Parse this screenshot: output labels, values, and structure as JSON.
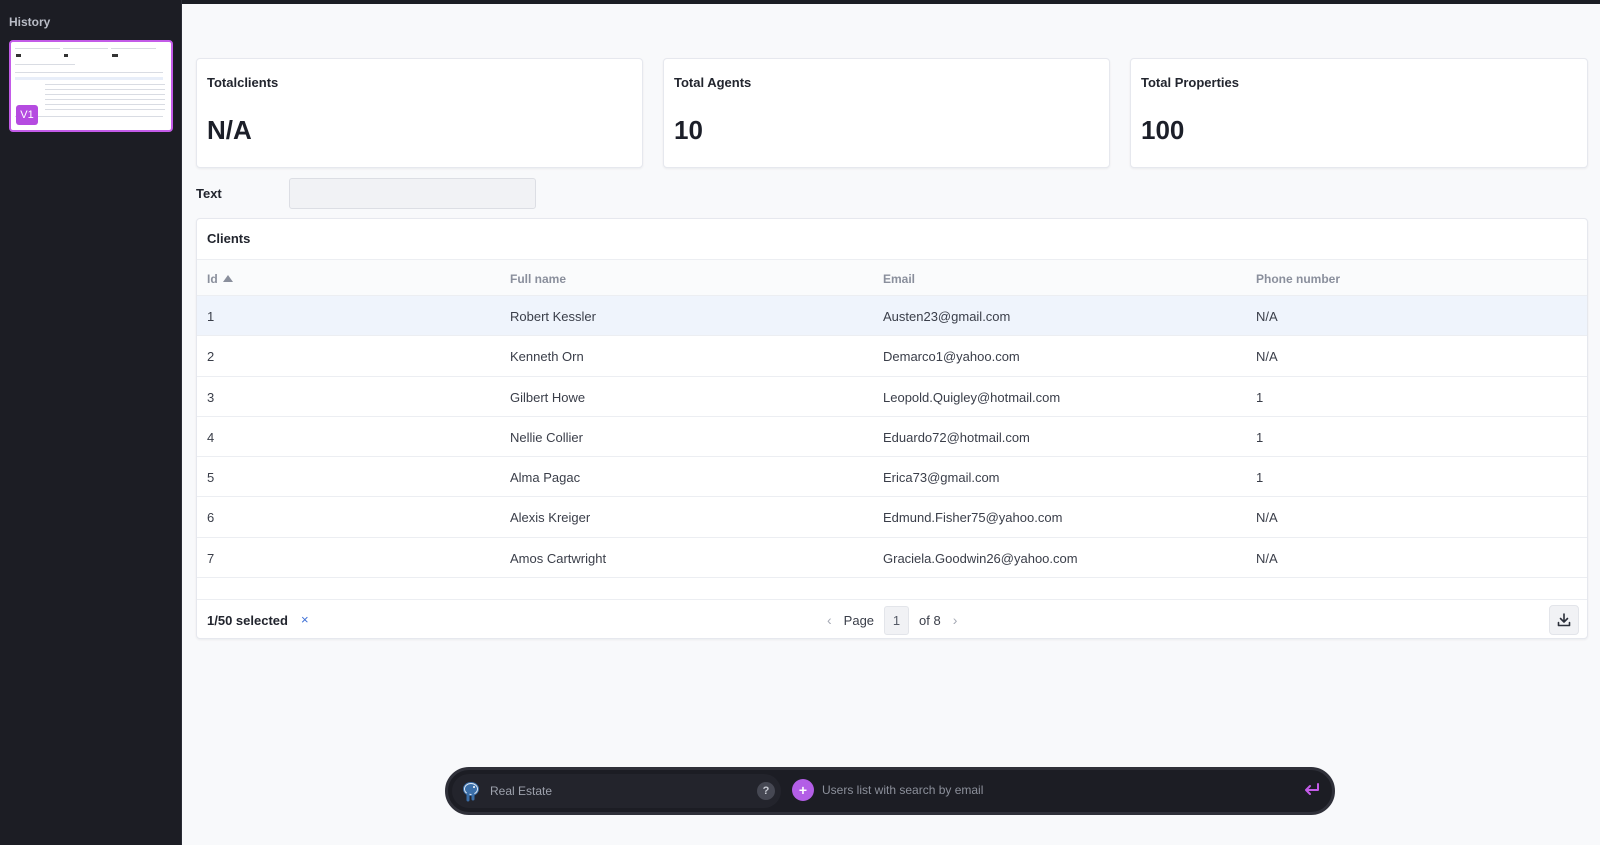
{
  "sidebar": {
    "title": "History",
    "versions": [
      {
        "label": "V1"
      }
    ]
  },
  "stats": [
    {
      "label": "Totalclients",
      "value": "N/A"
    },
    {
      "label": "Total Agents",
      "value": "10"
    },
    {
      "label": "Total Properties",
      "value": "100"
    }
  ],
  "filter": {
    "label": "Text",
    "value": "",
    "placeholder": ""
  },
  "table": {
    "title": "Clients",
    "columns": [
      "Id",
      "Full name",
      "Email",
      "Phone number"
    ],
    "sort_column": "Id",
    "rows": [
      {
        "id": "1",
        "name": "Robert Kessler",
        "email": "Austen23@gmail.com",
        "phone": "N/A"
      },
      {
        "id": "2",
        "name": "Kenneth Orn",
        "email": "Demarco1@yahoo.com",
        "phone": "N/A"
      },
      {
        "id": "3",
        "name": "Gilbert Howe",
        "email": "Leopold.Quigley@hotmail.com",
        "phone": "1"
      },
      {
        "id": "4",
        "name": "Nellie Collier",
        "email": "Eduardo72@hotmail.com",
        "phone": "1"
      },
      {
        "id": "5",
        "name": "Alma Pagac",
        "email": "Erica73@gmail.com",
        "phone": "1"
      },
      {
        "id": "6",
        "name": "Alexis Kreiger",
        "email": "Edmund.Fisher75@yahoo.com",
        "phone": "N/A"
      },
      {
        "id": "7",
        "name": "Amos Cartwright",
        "email": "Graciela.Goodwin26@yahoo.com",
        "phone": "N/A"
      }
    ],
    "selected_row": 0
  },
  "footer": {
    "selected_text": "1/50 selected",
    "clear_label": "×",
    "page_label": "Page",
    "page": "1",
    "of_label": "of 8"
  },
  "prompt": {
    "database": "Real Estate",
    "help": "?",
    "placeholder": "Users list with search by email"
  },
  "colors": {
    "accent": "#b35ee6",
    "selected_row": "#eff4fc",
    "link": "#3d6fd6"
  }
}
